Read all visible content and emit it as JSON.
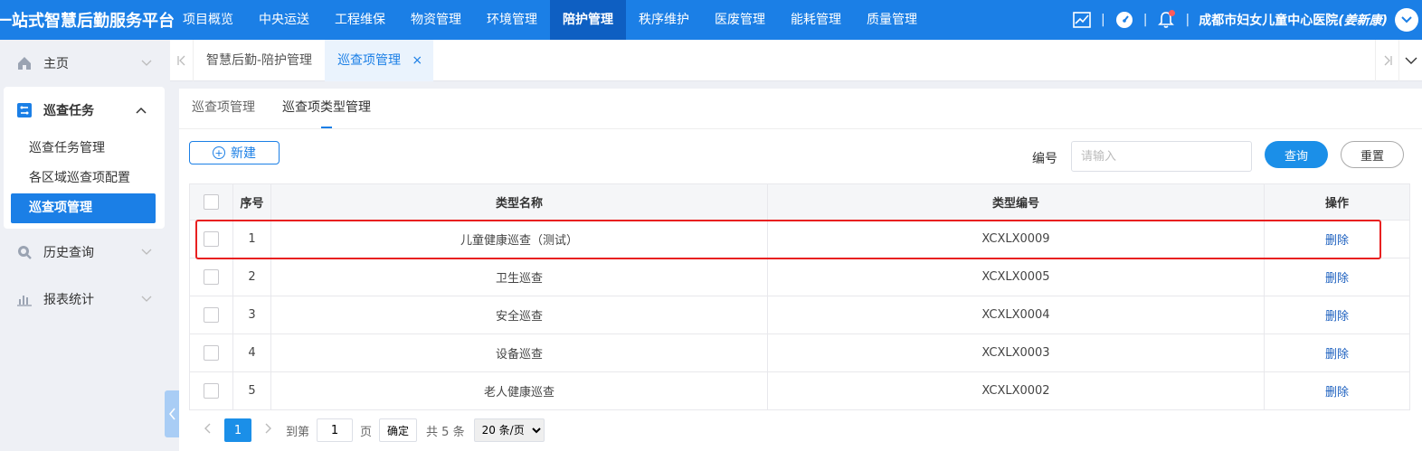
{
  "app": {
    "brand": "一站式智慧后勤服务平台",
    "top_nav": [
      {
        "label": "项目概览"
      },
      {
        "label": "中央运送"
      },
      {
        "label": "工程维保"
      },
      {
        "label": "物资管理"
      },
      {
        "label": "环境管理"
      },
      {
        "label": "陪护管理",
        "active": true
      },
      {
        "label": "秩序维护"
      },
      {
        "label": "医废管理"
      },
      {
        "label": "能耗管理"
      },
      {
        "label": "质量管理"
      }
    ],
    "separator": "|",
    "hospital": "成都市妇女儿童中心医院",
    "user": "(姜新康)"
  },
  "sidebar": {
    "home": "主页",
    "patrol_tasks": "巡查任务",
    "sub_items": [
      {
        "label": "巡查任务管理"
      },
      {
        "label": "各区域巡查项配置"
      },
      {
        "label": "巡查项管理",
        "active": true
      }
    ],
    "history": "历史查询",
    "reports": "报表统计"
  },
  "tabs": {
    "items": [
      {
        "label": "智慧后勤-陪护管理"
      },
      {
        "label": "巡查项管理",
        "active": true
      }
    ],
    "close_glyph": "×"
  },
  "subtabs": [
    {
      "label": "巡查项管理"
    },
    {
      "label": "巡查项类型管理",
      "active": true
    }
  ],
  "toolbar": {
    "new_label": "新建",
    "filter_label": "编号",
    "filter_placeholder": "请输入",
    "query_label": "查询",
    "reset_label": "重置"
  },
  "table": {
    "headers": [
      "序号",
      "类型名称",
      "类型编号",
      "操作"
    ],
    "rows": [
      {
        "no": "1",
        "name": "儿童健康巡查（测试）",
        "code": "XCXLX0009",
        "action": "删除"
      },
      {
        "no": "2",
        "name": "卫生巡查",
        "code": "XCXLX0005",
        "action": "删除"
      },
      {
        "no": "3",
        "name": "安全巡查",
        "code": "XCXLX0004",
        "action": "删除"
      },
      {
        "no": "4",
        "name": "设备巡查",
        "code": "XCXLX0003",
        "action": "删除"
      },
      {
        "no": "5",
        "name": "老人健康巡查",
        "code": "XCXLX0002",
        "action": "删除"
      }
    ]
  },
  "pager": {
    "current_page": "1",
    "goto_label": "到第",
    "goto_value": "1",
    "page_label": "页",
    "confirm_label": "确定",
    "total": "共 5 条",
    "page_size": "20 条/页"
  },
  "colors": {
    "primary": "#1b7fe6",
    "nav_active": "#0e5fc2",
    "highlight": "#e82020"
  }
}
